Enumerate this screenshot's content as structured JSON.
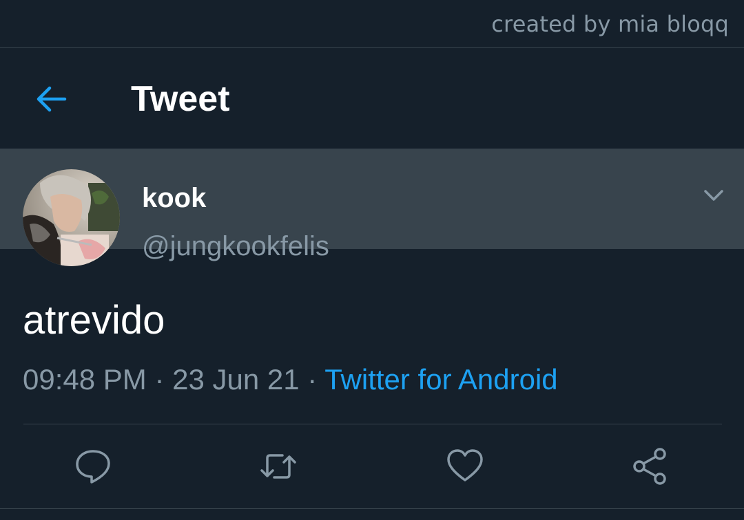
{
  "credit": "created by mia bloqq",
  "header": {
    "title": "Tweet",
    "back_icon": "arrow-left-icon"
  },
  "tweet": {
    "display_name": "kook",
    "handle": "@jungkookfelis",
    "text": "atrevido",
    "time": "09:48 PM",
    "separator": " · ",
    "date": "23 Jun 21",
    "source": "Twitter for Android"
  },
  "actions": [
    {
      "icon": "reply-icon"
    },
    {
      "icon": "retweet-icon"
    },
    {
      "icon": "like-icon"
    },
    {
      "icon": "share-icon"
    }
  ],
  "colors": {
    "background": "#15202b",
    "divider": "#38444d",
    "muted_text": "#8899a6",
    "accent": "#1da1f2"
  }
}
